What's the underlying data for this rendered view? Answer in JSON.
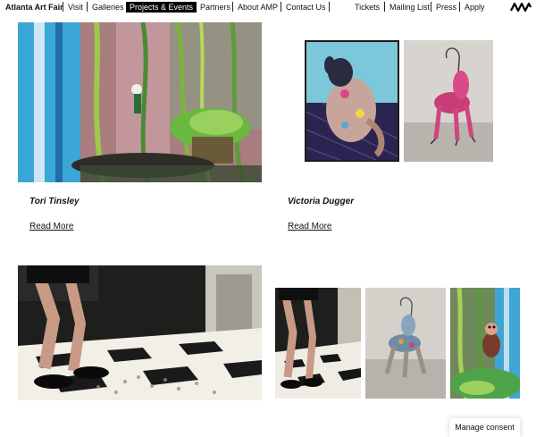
{
  "nav": {
    "brand": "Atlanta Art Fair",
    "links": [
      "Visit",
      "Galleries",
      "Projects & Events",
      "Partners",
      "About AMP",
      "Contact Us"
    ],
    "right_links": [
      "Tickets",
      "Mailing List",
      "Press",
      "Apply"
    ],
    "logo_icon": "amp-logo-icon"
  },
  "artists": [
    {
      "name": "Tori Tinsley",
      "link": "Read More"
    },
    {
      "name": "Victoria Dugger",
      "link": "Read More"
    }
  ],
  "consent": {
    "label": "Manage consent"
  }
}
